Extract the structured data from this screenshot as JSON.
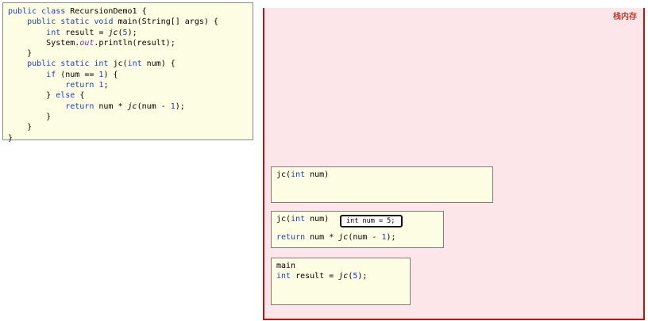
{
  "code": {
    "lines": [
      [
        {
          "t": "public class",
          "c": "kw"
        },
        {
          "t": " RecursionDemo1 {"
        }
      ],
      [
        {
          "t": "    "
        },
        {
          "t": "public static void",
          "c": "kw"
        },
        {
          "t": " main(String[] args) {"
        }
      ],
      [
        {
          "t": "        "
        },
        {
          "t": "int",
          "c": "kw"
        },
        {
          "t": " result = "
        },
        {
          "t": "jc",
          "c": "it"
        },
        {
          "t": "("
        },
        {
          "t": "5",
          "c": "num"
        },
        {
          "t": ");"
        }
      ],
      [
        {
          "t": "        System."
        },
        {
          "t": "out",
          "c": "static-ref"
        },
        {
          "t": ".println(result);"
        }
      ],
      [
        {
          "t": "    }"
        }
      ],
      [
        {
          "t": "    "
        },
        {
          "t": "public static int",
          "c": "kw"
        },
        {
          "t": " jc("
        },
        {
          "t": "int",
          "c": "kw"
        },
        {
          "t": " num) {"
        }
      ],
      [
        {
          "t": "        "
        },
        {
          "t": "if",
          "c": "kw"
        },
        {
          "t": " (num == "
        },
        {
          "t": "1",
          "c": "num"
        },
        {
          "t": ") {"
        }
      ],
      [
        {
          "t": "            "
        },
        {
          "t": "return",
          "c": "kw"
        },
        {
          "t": " "
        },
        {
          "t": "1",
          "c": "num"
        },
        {
          "t": ";"
        }
      ],
      [
        {
          "t": "        } "
        },
        {
          "t": "else",
          "c": "kw"
        },
        {
          "t": " {"
        }
      ],
      [
        {
          "t": "            "
        },
        {
          "t": "return",
          "c": "kw"
        },
        {
          "t": " num * "
        },
        {
          "t": "jc",
          "c": "it"
        },
        {
          "t": "(num - "
        },
        {
          "t": "1",
          "c": "num"
        },
        {
          "t": ");"
        }
      ],
      [
        {
          "t": "        }"
        }
      ],
      [
        {
          "t": "    }"
        }
      ],
      [
        {
          "t": "}"
        }
      ]
    ]
  },
  "stack": {
    "title": "栈内存",
    "frames": {
      "top": {
        "header": [
          {
            "t": "jc("
          },
          {
            "t": "int",
            "c": "kw"
          },
          {
            "t": " num)"
          }
        ]
      },
      "middle": {
        "header": [
          {
            "t": "jc("
          },
          {
            "t": "int",
            "c": "kw"
          },
          {
            "t": " num)"
          }
        ],
        "variable": "int num = 5;",
        "body": [
          {
            "t": "return",
            "c": "kw"
          },
          {
            "t": " num * "
          },
          {
            "t": "jc",
            "c": "it"
          },
          {
            "t": "(num - "
          },
          {
            "t": "1",
            "c": "num"
          },
          {
            "t": ");"
          }
        ]
      },
      "main": {
        "name": "main",
        "body": [
          {
            "t": "int",
            "c": "kw"
          },
          {
            "t": " result = "
          },
          {
            "t": "jc",
            "c": "it"
          },
          {
            "t": "("
          },
          {
            "t": "5",
            "c": "num"
          },
          {
            "t": ");"
          }
        ]
      }
    }
  }
}
